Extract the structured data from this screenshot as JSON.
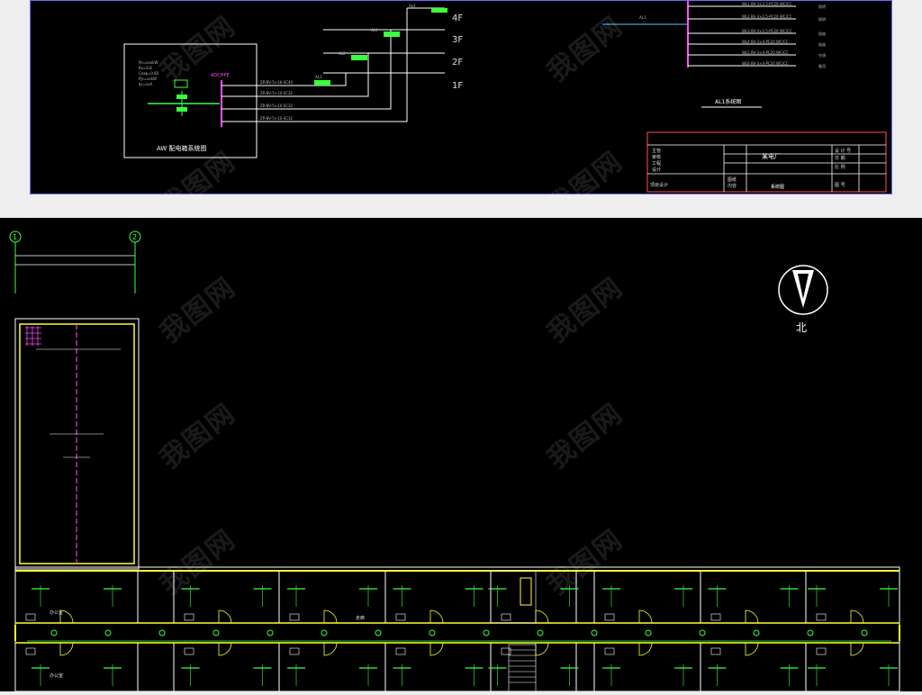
{
  "top": {
    "floors": [
      "4F",
      "3F",
      "2F",
      "1F"
    ],
    "aw_title": "AW 配电箱系统图",
    "aw_box_label": "ADCHPE",
    "aw_circuits": [
      "ZR-BV-5×16-SC40",
      "ZR-BV-5×10-SC32",
      "ZR-BV-5×10-SC32",
      "ZR-BV-5×10-SC32"
    ],
    "al1_title": "AL1系统图",
    "al1_circuits": [
      "WL1 BV-3×2.5-PC20 WC/CC",
      "WL2 BV-3×2.5-PC20 WC/CC",
      "WL3 BV-3×2.5-PC20 WC/CC",
      "WL4 BV-3×4-PC20 WC/CC",
      "WL5 BV-3×4-PC20 WC/CC",
      "WL6 BV-3×4-PC20 WC/CC"
    ],
    "title_block": {
      "project": "某电厂",
      "drawing": "系统图",
      "left_labels": [
        "主管",
        "审核",
        "工程",
        "设计"
      ],
      "right_labels": [
        "设 计 号",
        "日 期",
        "比 例",
        "图 号"
      ],
      "project_label": "项目设计",
      "sub_labels": [
        "图纸",
        "内容"
      ]
    }
  },
  "bottom": {
    "axis_labels": [
      "1",
      "2"
    ],
    "north_label": "北",
    "room_name": "办公室",
    "corridor_label": "走廊"
  },
  "watermark": "我图网"
}
